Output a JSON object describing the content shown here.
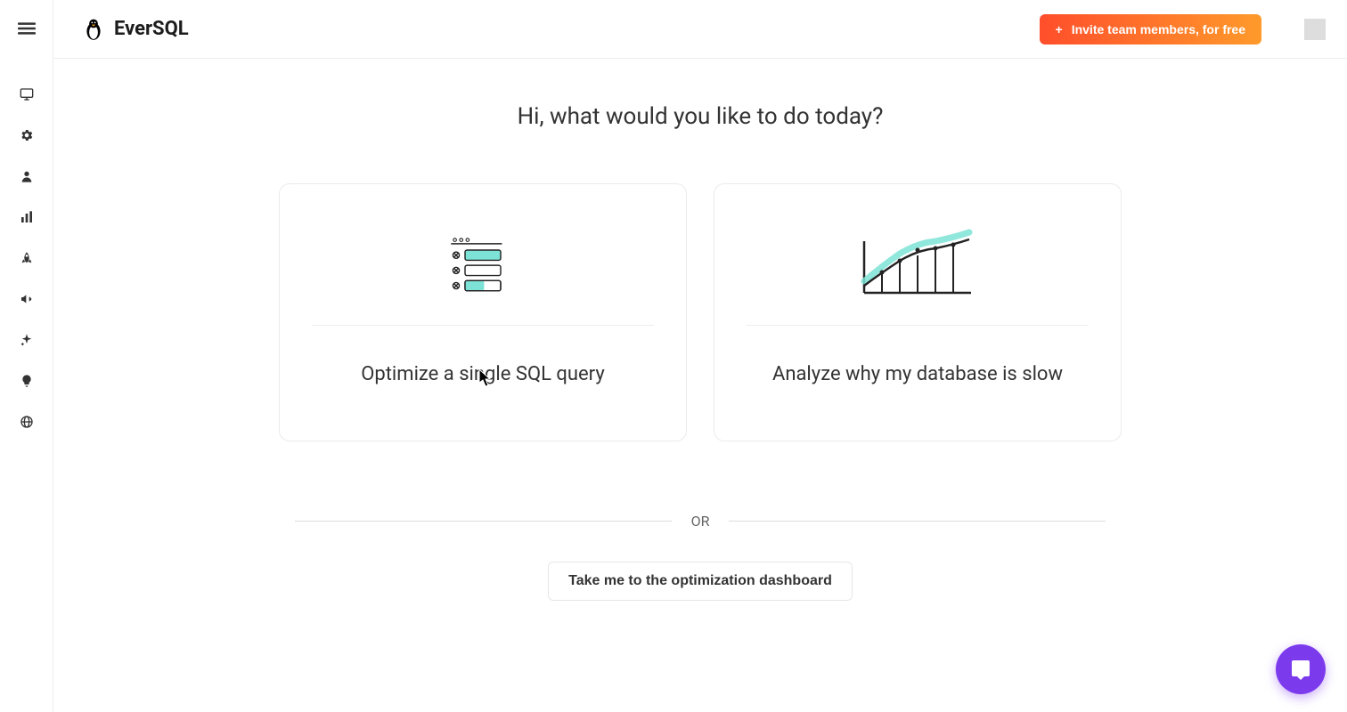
{
  "header": {
    "logo_text": "EverSQL",
    "invite_label": "Invite team members, for free"
  },
  "main": {
    "greeting": "Hi, what would you like to do today?",
    "cards": [
      {
        "title": "Optimize a single SQL query"
      },
      {
        "title": "Analyze why my database is slow"
      }
    ],
    "divider_label": "OR",
    "dashboard_button": "Take me to the optimization dashboard"
  },
  "sidebar": {
    "icons": [
      "monitor-icon",
      "gear-icon",
      "user-icon",
      "chart-icon",
      "rocket-icon",
      "megaphone-icon",
      "sparkle-icon",
      "lightbulb-icon",
      "globe-icon"
    ]
  }
}
